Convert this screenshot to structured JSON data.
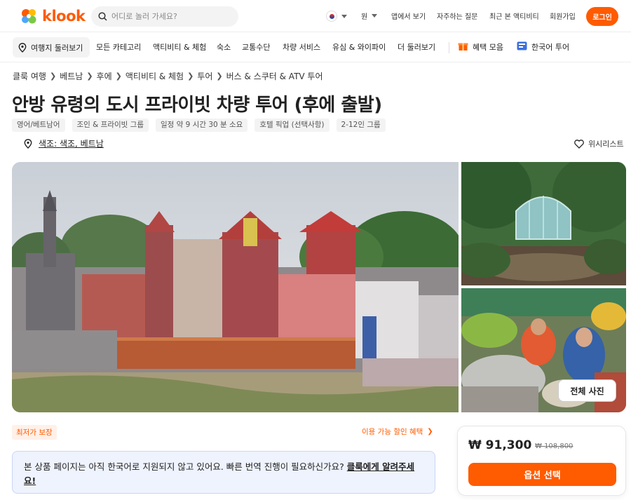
{
  "header": {
    "logo_text": "klook",
    "search_placeholder": "어디로 놀러 가세요?",
    "currency": "원",
    "links": [
      "앱에서 보기",
      "자주하는 질문",
      "최근 본 액티비티",
      "회원가입"
    ],
    "login_label": "로그인",
    "brand_color": "#ff5b00"
  },
  "catnav": {
    "explore_label": "여행지 둘러보기",
    "items": [
      "모든 카테고리",
      "액티비티 & 체험",
      "숙소",
      "교통수단",
      "차량 서비스",
      "유심 & 와이파이",
      "더 둘러보기"
    ],
    "benefits_label": "혜택 모음",
    "korean_tour_label": "한국어 투어"
  },
  "breadcrumb": [
    "클룩 여행",
    "베트남",
    "후에",
    "액티비티 & 체험",
    "투어",
    "버스 & 스쿠터 & ATV 투어"
  ],
  "product": {
    "title": "안방 유령의 도시 프라이빗 차량 투어 (후에 출발)",
    "tags": [
      "영어/베트남어",
      "조인 & 프라이빗 그룹",
      "일정 약 9 시간 30 분 소요",
      "호텔 픽업 (선택사항)",
      "2-12인 그룹"
    ],
    "location": "색조: 색조, 베트남",
    "wishlist_label": "위시리스트"
  },
  "gallery": {
    "all_photos_label": "전체 사진"
  },
  "offers": {
    "best_price_label": "최저가 보장",
    "discount_link_label": "이용 가능 할인 혜택"
  },
  "notice": {
    "text": "본 상품 페이지는 아직 한국어로 지원되지 않고 있어요. 빠른 번역 진행이 필요하신가요? ",
    "link_text": "클룩에게 알려주세요!"
  },
  "price": {
    "current": "₩ 91,300",
    "original": "₩ 108,800",
    "select_button": "옵션 선택"
  }
}
